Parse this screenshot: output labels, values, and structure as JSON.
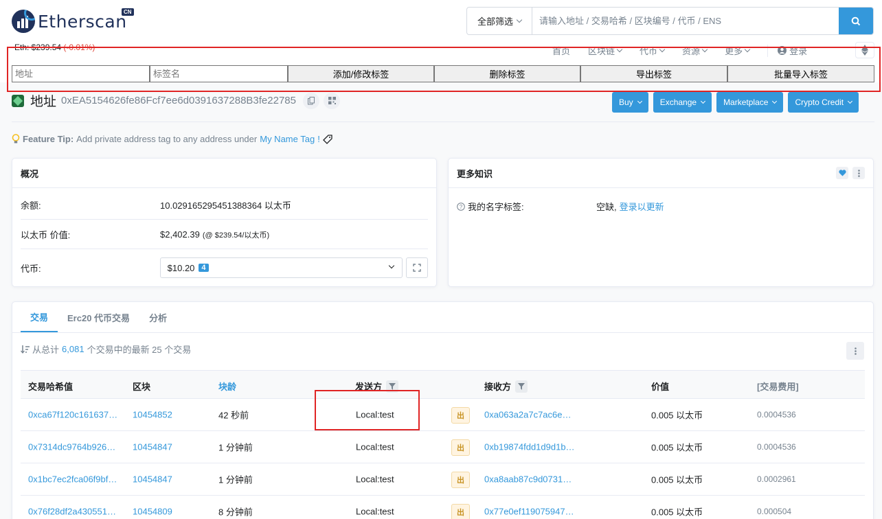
{
  "header": {
    "logo_text": "Etherscan",
    "logo_badge": "CN",
    "search_filter": "全部筛选",
    "search_placeholder": "请输入地址 / 交易哈希 / 区块编号 / 代币 / ENS",
    "eth_price": "Eth: $239.54",
    "eth_change": "(-0.01%)",
    "nav": [
      "首页",
      "区块链",
      "代币",
      "资源",
      "更多"
    ],
    "login": "登录"
  },
  "tagbar": {
    "address_placeholder": "地址",
    "tag_placeholder": "标签名",
    "buttons": [
      "添加/修改标签",
      "删除标签",
      "导出标签",
      "批量导入标签"
    ]
  },
  "address": {
    "label": "地址",
    "hash": "0xEA5154626fe86Fcf7ee6d0391637288B3fe22785",
    "buttons": [
      "Buy",
      "Exchange",
      "Marketplace",
      "Crypto Credit"
    ]
  },
  "tip": {
    "title": "Feature Tip:",
    "text": "Add private address tag to any address under",
    "link": "My Name Tag",
    "suffix": "!"
  },
  "overview": {
    "title": "概况",
    "balance_label": "余额:",
    "balance_value": "10.029165295451388364 以太币",
    "value_label": "以太币 价值:",
    "value_main": "$2,402.39",
    "value_sub": "(@ $239.54/以太币)",
    "token_label": "代币:",
    "token_value": "$10.20",
    "token_count": "4"
  },
  "more_info": {
    "title": "更多知识",
    "nametag_label": "我的名字标签:",
    "nametag_value": "空缺,",
    "nametag_link": "登录以更新"
  },
  "tx": {
    "tabs": [
      "交易",
      "Erc20 代币交易",
      "分析"
    ],
    "summary_prefix": "从总计",
    "summary_count": "6,081",
    "summary_suffix": "个交易中的最新 25 个交易",
    "columns": [
      "交易哈希值",
      "区块",
      "块龄",
      "发送方",
      "接收方",
      "价值",
      "[交易费用]"
    ],
    "rows": [
      {
        "hash": "0xca67f120c161637…",
        "block": "10454852",
        "age": "42 秒前",
        "from": "Local:test",
        "dir": "出",
        "to": "0xa063a2a7c7ac6e…",
        "value": "0.005 以太币",
        "fee": "0.0004536"
      },
      {
        "hash": "0x7314dc9764b926…",
        "block": "10454847",
        "age": "1 分钟前",
        "from": "Local:test",
        "dir": "出",
        "to": "0xb19874fdd1d9d1b…",
        "value": "0.005 以太币",
        "fee": "0.0004536"
      },
      {
        "hash": "0x1bc7ec2fca06f9bf…",
        "block": "10454847",
        "age": "1 分钟前",
        "from": "Local:test",
        "dir": "出",
        "to": "0xa8aab87c9d0731…",
        "value": "0.005 以太币",
        "fee": "0.0002961"
      },
      {
        "hash": "0x76f28df2a430551…",
        "block": "10454809",
        "age": "8 分钟前",
        "from": "Local:test",
        "dir": "出",
        "to": "0x77e0ef119075947…",
        "value": "0.005 以太币",
        "fee": "0.000504"
      }
    ]
  },
  "colors": {
    "accent": "#3498db",
    "annotation": "#e02424",
    "out_badge": "#fff4e1"
  }
}
